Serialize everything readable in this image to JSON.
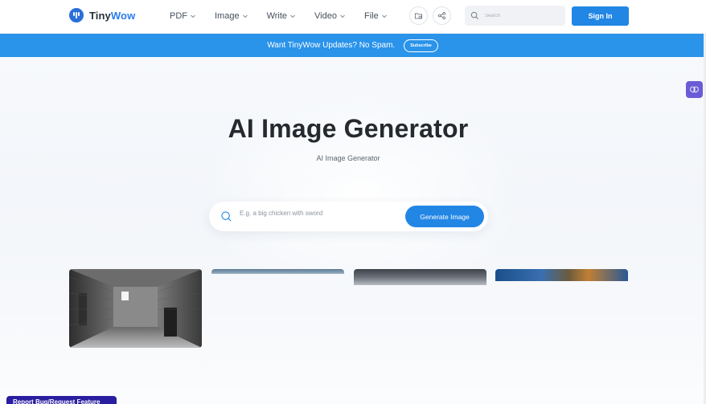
{
  "brand": {
    "name_part1": "Tiny",
    "name_part2": "Wow",
    "logo_icon": "tinywow-logo-icon"
  },
  "nav": {
    "items": [
      {
        "label": "PDF"
      },
      {
        "label": "Image"
      },
      {
        "label": "Write"
      },
      {
        "label": "Video"
      },
      {
        "label": "File"
      }
    ],
    "folder_icon": "folder-icon",
    "share_icon": "share-icon",
    "search_placeholder": "Search",
    "signin_label": "Sign In"
  },
  "banner": {
    "text": "Want TinyWow Updates? No Spam.",
    "subscribe_label": "Subscribe"
  },
  "hero": {
    "title": "AI Image Generator",
    "subtitle": "AI Image Generator",
    "prompt_placeholder": "E.g. a big chicken with sword",
    "generate_label": "Generate Image"
  },
  "side_widget": {
    "icon": "brain-icon"
  },
  "report": {
    "label": "Report Bug/Request Feature"
  },
  "colors": {
    "accent": "#2286e5",
    "banner": "#2a93ea",
    "widget": "#6b5bd6",
    "report": "#2a1ea0"
  }
}
